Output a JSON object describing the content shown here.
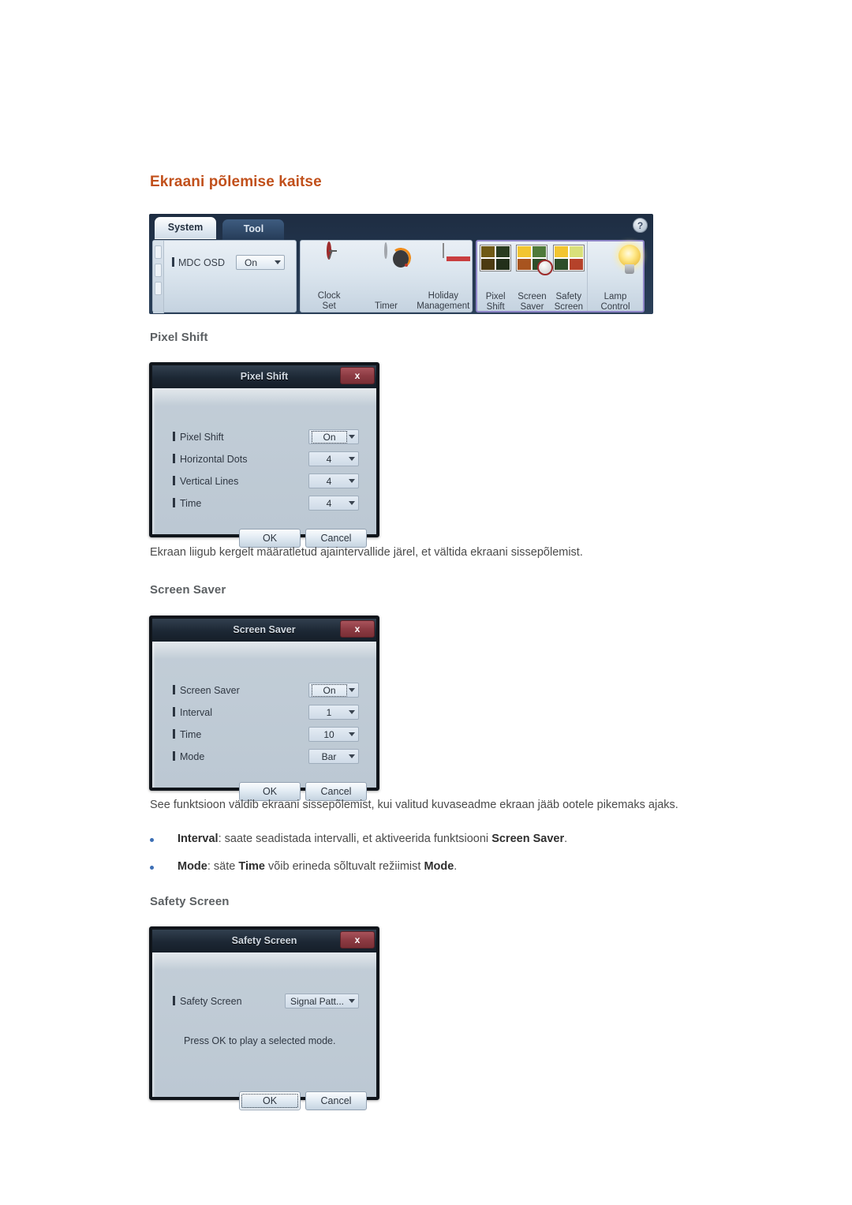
{
  "page": {
    "heading": "Ekraani põlemise kaitse",
    "accent_color": "#c1501b"
  },
  "ribbon": {
    "tabs": [
      {
        "label": "System",
        "active": true
      },
      {
        "label": "Tool",
        "active": false
      }
    ],
    "help_label": "?",
    "osd": {
      "label": "MDC OSD",
      "value": "On"
    },
    "groups": [
      {
        "name": "schedule",
        "items": [
          {
            "line1": "Clock",
            "line2": "Set",
            "icon": "clock-icon"
          },
          {
            "line1": "Timer",
            "line2": "",
            "icon": "timer-icon"
          },
          {
            "line1": "Holiday",
            "line2": "Management",
            "icon": "calendar-icon"
          }
        ]
      },
      {
        "name": "screen-burn-protection",
        "highlighted": true,
        "items": [
          {
            "line1": "Pixel",
            "line2": "Shift",
            "icon": "pixel-shift-icon"
          },
          {
            "line1": "Screen",
            "line2": "Saver",
            "icon": "screen-saver-icon"
          },
          {
            "line1": "Safety",
            "line2": "Screen",
            "icon": "safety-screen-icon"
          },
          {
            "line1": "Lamp",
            "line2": "Control",
            "icon": "lamp-icon"
          }
        ]
      }
    ]
  },
  "sections": [
    {
      "id": "pixel_shift",
      "heading": "Pixel Shift"
    },
    {
      "id": "screen_saver",
      "heading": "Screen Saver"
    },
    {
      "id": "safety_screen",
      "heading": "Safety Screen"
    }
  ],
  "pixel_shift_dialog": {
    "title": "Pixel Shift",
    "close_label": "x",
    "rows": [
      {
        "label": "Pixel Shift",
        "value": "On",
        "focused": true
      },
      {
        "label": "Horizontal Dots",
        "value": "4",
        "focused": false
      },
      {
        "label": "Vertical Lines",
        "value": "4",
        "focused": false
      },
      {
        "label": "Time",
        "value": "4",
        "focused": false
      }
    ],
    "ok_label": "OK",
    "cancel_label": "Cancel"
  },
  "pixel_shift_text": "Ekraan liigub kergelt määratletud ajaintervallide järel, et vältida ekraani sissepõlemist.",
  "screen_saver_dialog": {
    "title": "Screen Saver",
    "close_label": "x",
    "rows": [
      {
        "label": "Screen Saver",
        "value": "On",
        "focused": true
      },
      {
        "label": "Interval",
        "value": "1",
        "focused": false
      },
      {
        "label": "Time",
        "value": "10",
        "focused": false
      },
      {
        "label": "Mode",
        "value": "Bar",
        "focused": false
      }
    ],
    "ok_label": "OK",
    "cancel_label": "Cancel"
  },
  "screen_saver_text": "See funktsioon väldib ekraani sissepõlemist, kui valitud kuvaseadme ekraan jääb ootele pikemaks ajaks.",
  "bullets": [
    {
      "parts": [
        {
          "t": "Interval",
          "b": true
        },
        {
          "t": ": saate seadistada intervalli, et aktiveerida funktsiooni ",
          "b": false
        },
        {
          "t": "Screen Saver",
          "b": true
        },
        {
          "t": ".",
          "b": false
        }
      ]
    },
    {
      "parts": [
        {
          "t": "Mode",
          "b": true
        },
        {
          "t": ": säte ",
          "b": false
        },
        {
          "t": "Time",
          "b": true
        },
        {
          "t": " võib erineda sõltuvalt režiimist ",
          "b": false
        },
        {
          "t": "Mode",
          "b": true
        },
        {
          "t": ".",
          "b": false
        }
      ]
    }
  ],
  "safety_screen_dialog": {
    "title": "Safety Screen",
    "close_label": "x",
    "rows": [
      {
        "label": "Safety Screen",
        "value": "Signal Patt...",
        "focused": false
      }
    ],
    "note": "Press OK to play a selected mode.",
    "ok_label": "OK",
    "cancel_label": "Cancel"
  }
}
